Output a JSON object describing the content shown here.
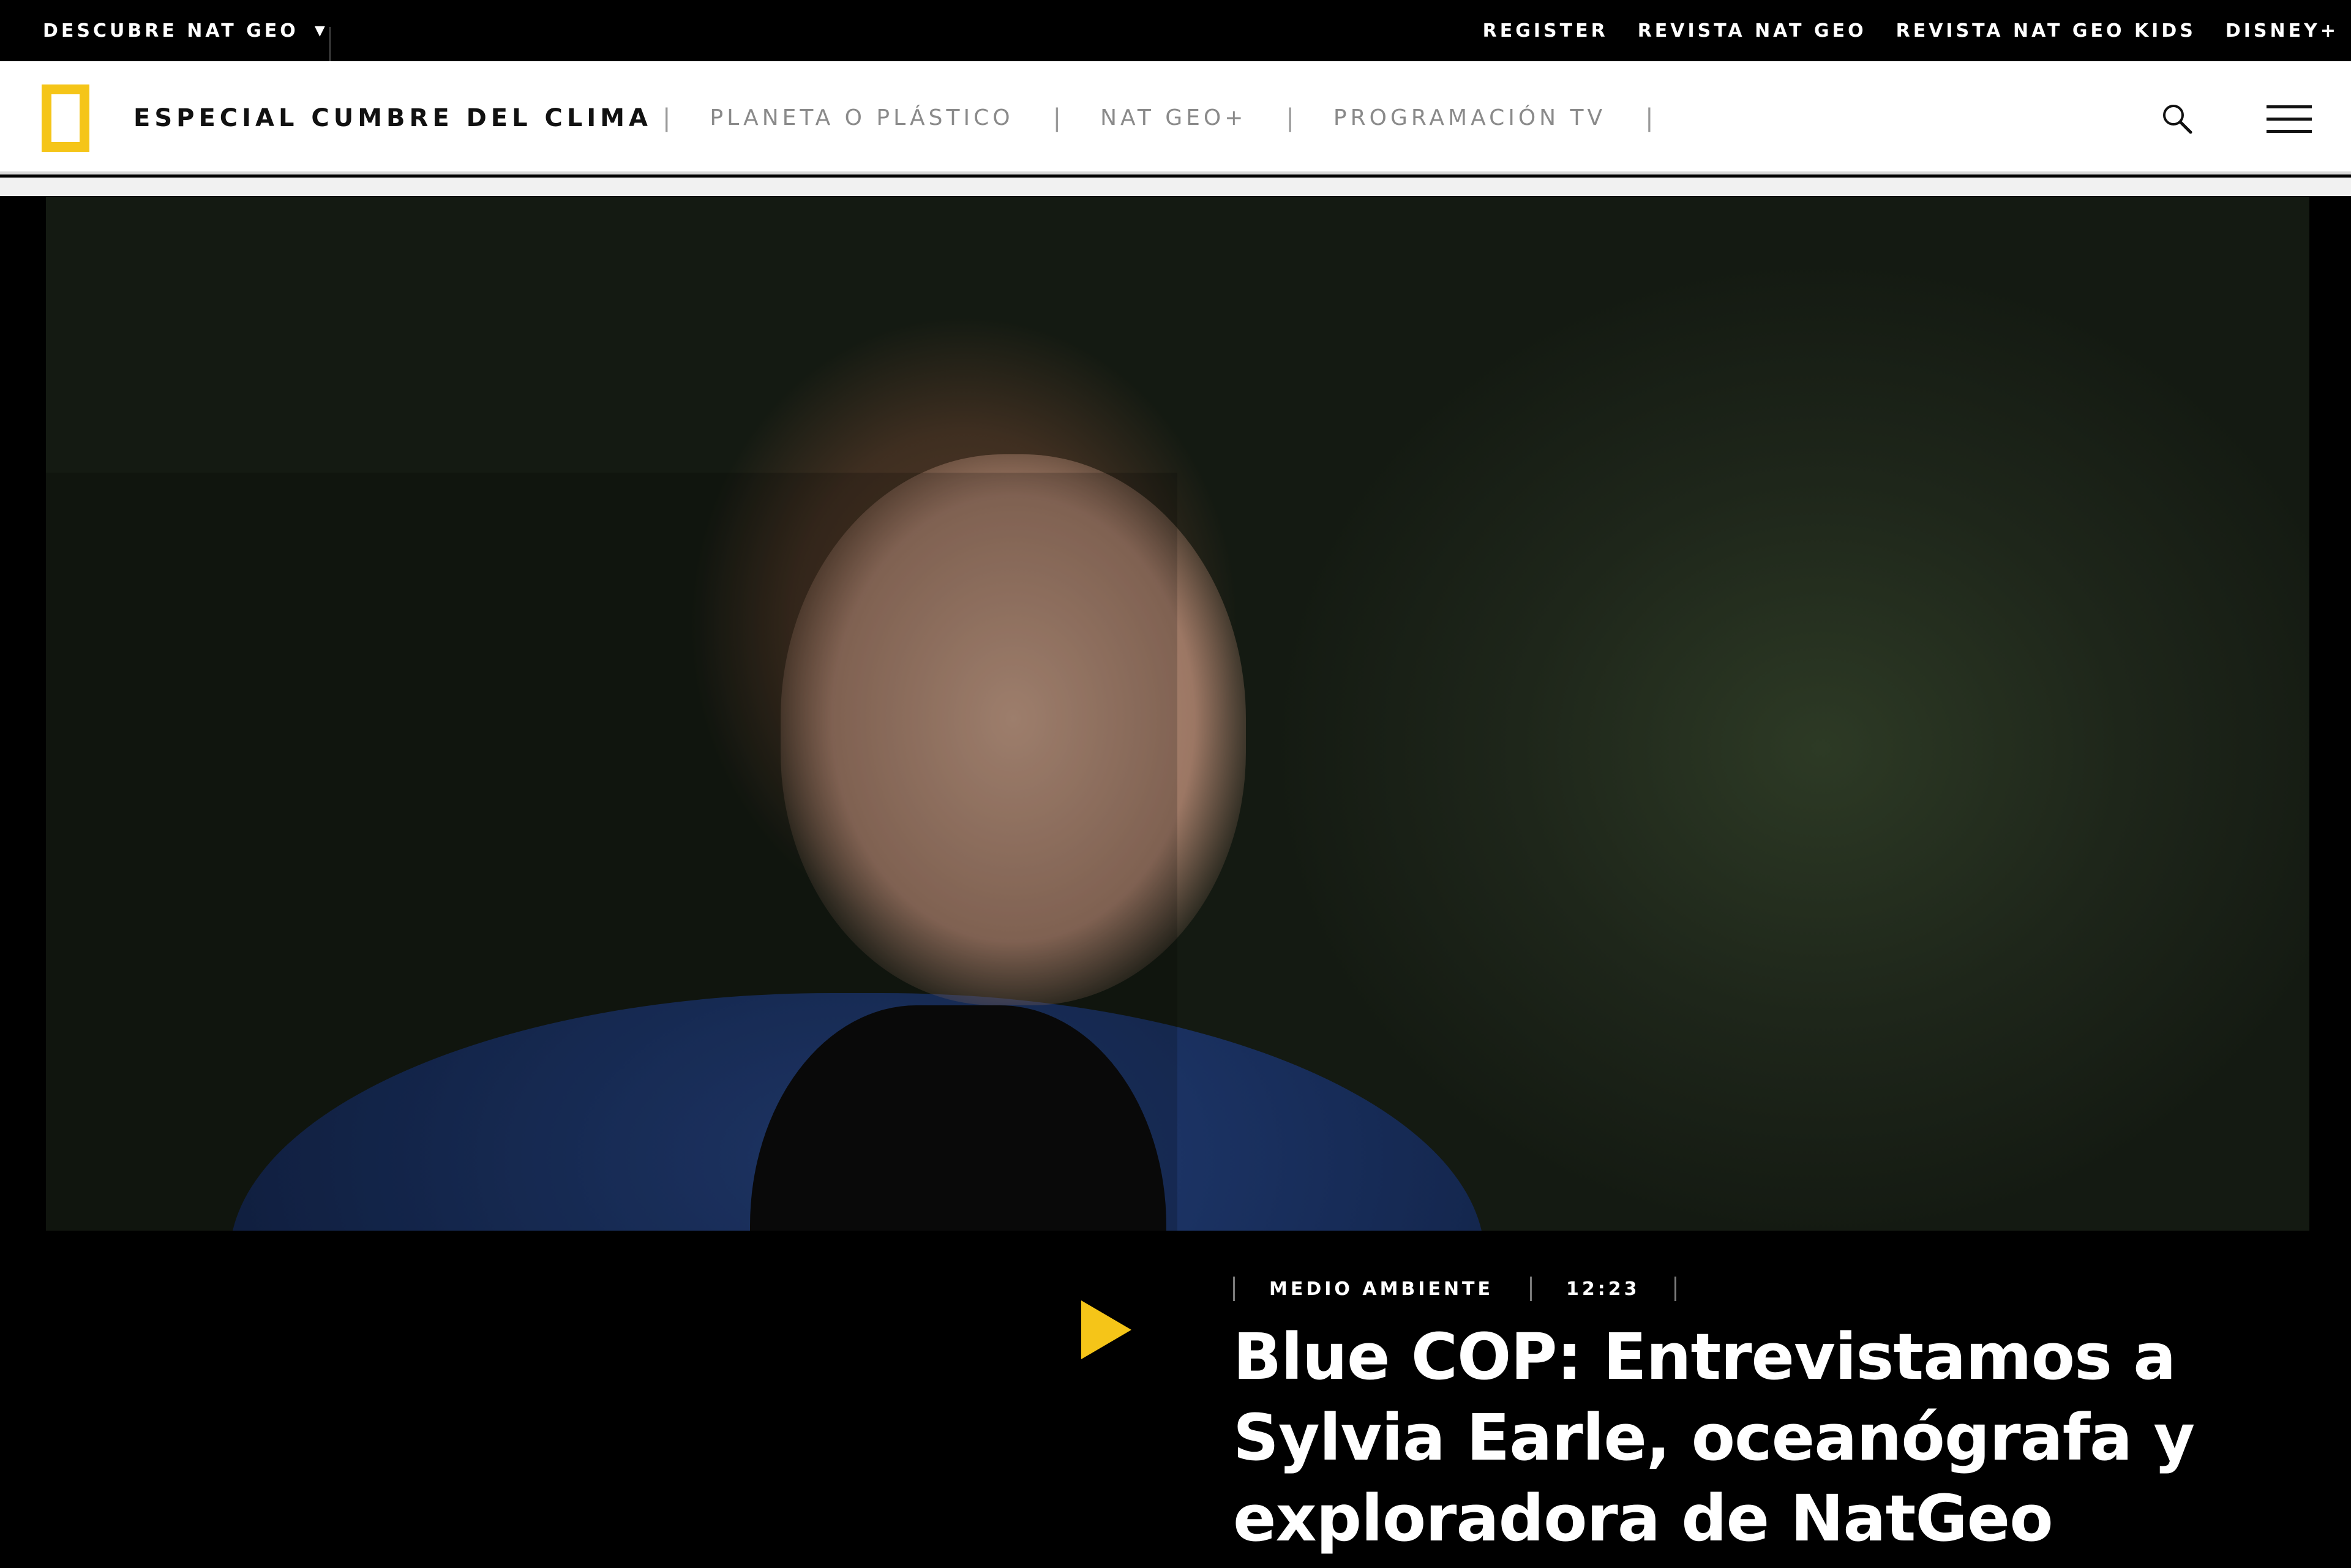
{
  "topbar": {
    "discover_label": "DESCUBRE NAT GEO",
    "links": [
      "REGISTER",
      "REVISTA NAT GEO",
      "REVISTA NAT GEO KIDS",
      "DISNEY+"
    ]
  },
  "header": {
    "site_title": "ESPECIAL CUMBRE DEL CLIMA",
    "nav": [
      "PLANETA O PLÁSTICO",
      "NAT GEO+",
      "PROGRAMACIÓN TV"
    ]
  },
  "icons": {
    "logo": "nat-geo-yellow-rectangle",
    "search": "search-icon",
    "menu": "hamburger-menu-icon",
    "play": "play-icon"
  },
  "colors": {
    "brand_yellow": "#f5c518",
    "topbar_bg": "#000000",
    "header_bg": "#ffffff",
    "nav_text": "#8a8a8a"
  },
  "video": {
    "category": "MEDIO AMBIENTE",
    "duration": "12:23",
    "title": "Blue COP: Entrevistamos a Sylvia Earle, oceanógrafa y exploradora de NatGeo"
  }
}
